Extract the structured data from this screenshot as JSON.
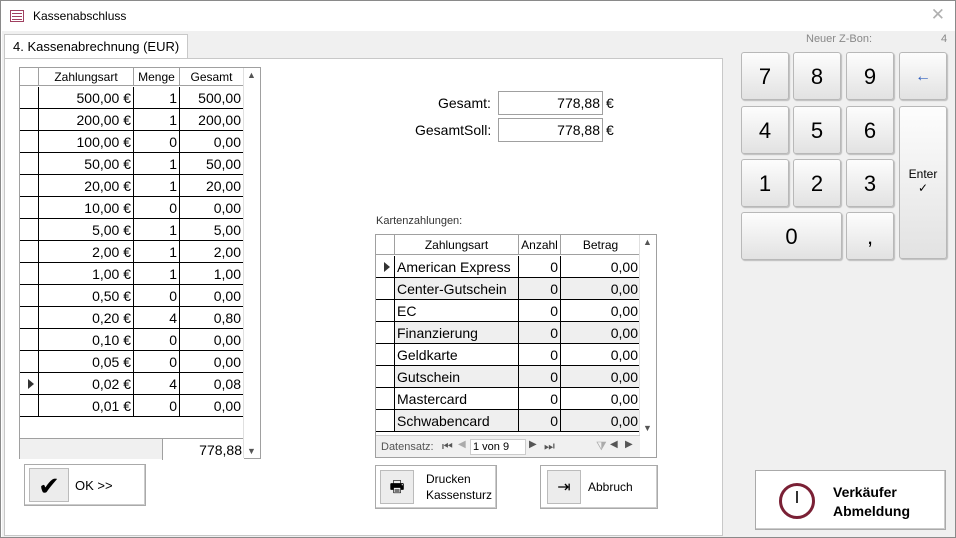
{
  "window": {
    "title": "Kassenabschluss",
    "close_glyph": "✕"
  },
  "tab": {
    "label": "4. Kassenabrechnung (EUR)"
  },
  "zbon": {
    "label": "Neuer Z-Bon:",
    "value": "4"
  },
  "cash_grid": {
    "headers": [
      "Zahlungsart",
      "Menge",
      "Gesamt"
    ],
    "rows": [
      {
        "art": "500,00 €",
        "menge": "1",
        "gesamt": "500,00"
      },
      {
        "art": "200,00 €",
        "menge": "1",
        "gesamt": "200,00"
      },
      {
        "art": "100,00 €",
        "menge": "0",
        "gesamt": "0,00"
      },
      {
        "art": "50,00 €",
        "menge": "1",
        "gesamt": "50,00"
      },
      {
        "art": "20,00 €",
        "menge": "1",
        "gesamt": "20,00"
      },
      {
        "art": "10,00 €",
        "menge": "0",
        "gesamt": "0,00"
      },
      {
        "art": "5,00 €",
        "menge": "1",
        "gesamt": "5,00"
      },
      {
        "art": "2,00 €",
        "menge": "1",
        "gesamt": "2,00"
      },
      {
        "art": "1,00 €",
        "menge": "1",
        "gesamt": "1,00"
      },
      {
        "art": "0,50 €",
        "menge": "0",
        "gesamt": "0,00"
      },
      {
        "art": "0,20 €",
        "menge": "4",
        "gesamt": "0,80"
      },
      {
        "art": "0,10 €",
        "menge": "0",
        "gesamt": "0,00"
      },
      {
        "art": "0,05 €",
        "menge": "0",
        "gesamt": "0,00"
      },
      {
        "art": "0,02 €",
        "menge": "4",
        "gesamt": "0,08"
      },
      {
        "art": "0,01 €",
        "menge": "0",
        "gesamt": "0,00"
      }
    ],
    "total": "778,88"
  },
  "ok_button": {
    "label": "OK >>",
    "icon": "checkmark-icon"
  },
  "totals": {
    "gesamt_label": "Gesamt:",
    "gesamt_value": "778,88",
    "soll_label": "GesamtSoll:",
    "soll_value": "778,88",
    "currency": "€"
  },
  "card_payments": {
    "label": "Kartenzahlungen:",
    "headers": [
      "Zahlungsart",
      "Anzahl",
      "Betrag"
    ],
    "rows": [
      {
        "art": "American Express",
        "anzahl": "0",
        "betrag": "0,00"
      },
      {
        "art": "Center-Gutschein",
        "anzahl": "0",
        "betrag": "0,00"
      },
      {
        "art": "EC",
        "anzahl": "0",
        "betrag": "0,00"
      },
      {
        "art": "Finanzierung",
        "anzahl": "0",
        "betrag": "0,00"
      },
      {
        "art": "Geldkarte",
        "anzahl": "0",
        "betrag": "0,00"
      },
      {
        "art": "Gutschein",
        "anzahl": "0",
        "betrag": "0,00"
      },
      {
        "art": "Mastercard",
        "anzahl": "0",
        "betrag": "0,00"
      },
      {
        "art": "Schwabencard",
        "anzahl": "0",
        "betrag": "0,00"
      }
    ],
    "nav": {
      "label": "Datensatz:",
      "record": "1 von 9"
    }
  },
  "print_button": {
    "line1": "Drucken",
    "line2": "Kassensturz",
    "icon": "printer-icon"
  },
  "cancel_button": {
    "label": "Abbruch",
    "icon": "exit-door-icon"
  },
  "keypad": {
    "keys": [
      "7",
      "8",
      "9",
      "4",
      "5",
      "6",
      "1",
      "2",
      "3",
      "0",
      ","
    ],
    "backspace": "←",
    "enter": "Enter",
    "enter_glyph": "✓"
  },
  "logout_button": {
    "line1": "Verkäufer",
    "line2": "Abmeldung",
    "icon": "clock-icon"
  }
}
